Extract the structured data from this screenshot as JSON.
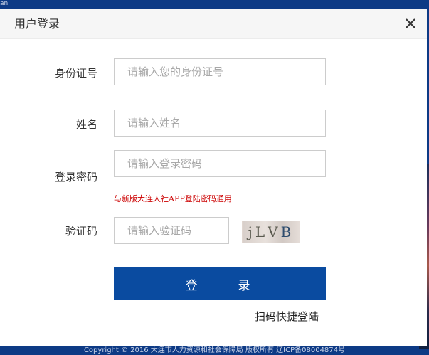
{
  "background": {
    "corner_text": "an",
    "footer": "Copyright © 2016 大连市人力资源和社会保障局 版权所有    辽ICP备08004874号"
  },
  "dialog": {
    "title": "用户登录",
    "close_icon": "close-icon",
    "fields": {
      "id": {
        "label": "身份证号",
        "placeholder": "请输入您的身份证号",
        "value": ""
      },
      "name": {
        "label": "姓名",
        "placeholder": "请输入姓名",
        "value": ""
      },
      "password": {
        "label": "登录密码",
        "placeholder": "请输入登录密码",
        "value": ""
      },
      "captcha": {
        "label": "验证码",
        "placeholder": "请输入验证码",
        "value": ""
      }
    },
    "password_hint": "与新版大连人社APP登陆密码通用",
    "captcha_image": {
      "c1": "j",
      "c2": "L",
      "c3": "V",
      "c4": "B"
    },
    "login_button": "登　录",
    "qr_login_link": "扫码快捷登陆"
  },
  "colors": {
    "page_bg": "#0d3a85",
    "primary_button": "#0a4ba0",
    "hint_text": "#cc0000"
  }
}
